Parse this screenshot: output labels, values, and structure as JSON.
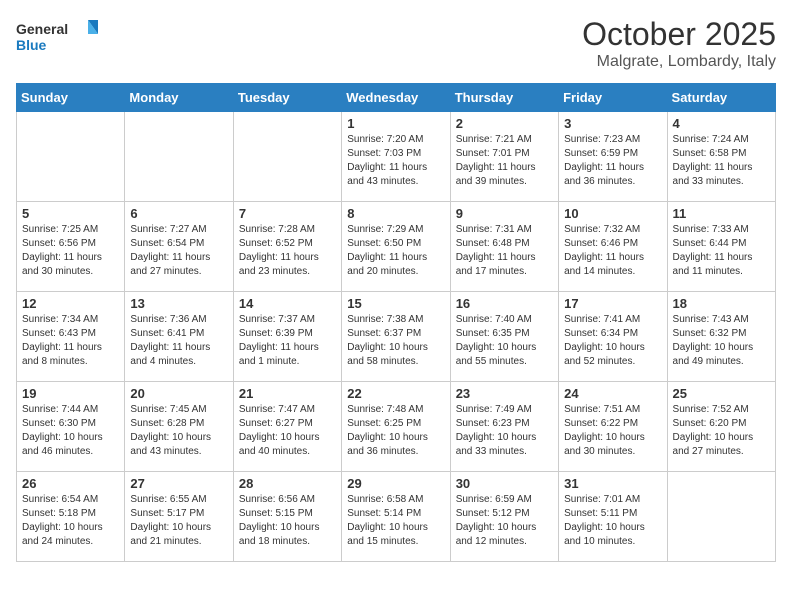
{
  "header": {
    "logo_line1": "General",
    "logo_line2": "Blue",
    "month": "October 2025",
    "location": "Malgrate, Lombardy, Italy"
  },
  "days_of_week": [
    "Sunday",
    "Monday",
    "Tuesday",
    "Wednesday",
    "Thursday",
    "Friday",
    "Saturday"
  ],
  "weeks": [
    [
      {
        "day": "",
        "info": ""
      },
      {
        "day": "",
        "info": ""
      },
      {
        "day": "",
        "info": ""
      },
      {
        "day": "1",
        "info": "Sunrise: 7:20 AM\nSunset: 7:03 PM\nDaylight: 11 hours\nand 43 minutes."
      },
      {
        "day": "2",
        "info": "Sunrise: 7:21 AM\nSunset: 7:01 PM\nDaylight: 11 hours\nand 39 minutes."
      },
      {
        "day": "3",
        "info": "Sunrise: 7:23 AM\nSunset: 6:59 PM\nDaylight: 11 hours\nand 36 minutes."
      },
      {
        "day": "4",
        "info": "Sunrise: 7:24 AM\nSunset: 6:58 PM\nDaylight: 11 hours\nand 33 minutes."
      }
    ],
    [
      {
        "day": "5",
        "info": "Sunrise: 7:25 AM\nSunset: 6:56 PM\nDaylight: 11 hours\nand 30 minutes."
      },
      {
        "day": "6",
        "info": "Sunrise: 7:27 AM\nSunset: 6:54 PM\nDaylight: 11 hours\nand 27 minutes."
      },
      {
        "day": "7",
        "info": "Sunrise: 7:28 AM\nSunset: 6:52 PM\nDaylight: 11 hours\nand 23 minutes."
      },
      {
        "day": "8",
        "info": "Sunrise: 7:29 AM\nSunset: 6:50 PM\nDaylight: 11 hours\nand 20 minutes."
      },
      {
        "day": "9",
        "info": "Sunrise: 7:31 AM\nSunset: 6:48 PM\nDaylight: 11 hours\nand 17 minutes."
      },
      {
        "day": "10",
        "info": "Sunrise: 7:32 AM\nSunset: 6:46 PM\nDaylight: 11 hours\nand 14 minutes."
      },
      {
        "day": "11",
        "info": "Sunrise: 7:33 AM\nSunset: 6:44 PM\nDaylight: 11 hours\nand 11 minutes."
      }
    ],
    [
      {
        "day": "12",
        "info": "Sunrise: 7:34 AM\nSunset: 6:43 PM\nDaylight: 11 hours\nand 8 minutes."
      },
      {
        "day": "13",
        "info": "Sunrise: 7:36 AM\nSunset: 6:41 PM\nDaylight: 11 hours\nand 4 minutes."
      },
      {
        "day": "14",
        "info": "Sunrise: 7:37 AM\nSunset: 6:39 PM\nDaylight: 11 hours\nand 1 minute."
      },
      {
        "day": "15",
        "info": "Sunrise: 7:38 AM\nSunset: 6:37 PM\nDaylight: 10 hours\nand 58 minutes."
      },
      {
        "day": "16",
        "info": "Sunrise: 7:40 AM\nSunset: 6:35 PM\nDaylight: 10 hours\nand 55 minutes."
      },
      {
        "day": "17",
        "info": "Sunrise: 7:41 AM\nSunset: 6:34 PM\nDaylight: 10 hours\nand 52 minutes."
      },
      {
        "day": "18",
        "info": "Sunrise: 7:43 AM\nSunset: 6:32 PM\nDaylight: 10 hours\nand 49 minutes."
      }
    ],
    [
      {
        "day": "19",
        "info": "Sunrise: 7:44 AM\nSunset: 6:30 PM\nDaylight: 10 hours\nand 46 minutes."
      },
      {
        "day": "20",
        "info": "Sunrise: 7:45 AM\nSunset: 6:28 PM\nDaylight: 10 hours\nand 43 minutes."
      },
      {
        "day": "21",
        "info": "Sunrise: 7:47 AM\nSunset: 6:27 PM\nDaylight: 10 hours\nand 40 minutes."
      },
      {
        "day": "22",
        "info": "Sunrise: 7:48 AM\nSunset: 6:25 PM\nDaylight: 10 hours\nand 36 minutes."
      },
      {
        "day": "23",
        "info": "Sunrise: 7:49 AM\nSunset: 6:23 PM\nDaylight: 10 hours\nand 33 minutes."
      },
      {
        "day": "24",
        "info": "Sunrise: 7:51 AM\nSunset: 6:22 PM\nDaylight: 10 hours\nand 30 minutes."
      },
      {
        "day": "25",
        "info": "Sunrise: 7:52 AM\nSunset: 6:20 PM\nDaylight: 10 hours\nand 27 minutes."
      }
    ],
    [
      {
        "day": "26",
        "info": "Sunrise: 6:54 AM\nSunset: 5:18 PM\nDaylight: 10 hours\nand 24 minutes."
      },
      {
        "day": "27",
        "info": "Sunrise: 6:55 AM\nSunset: 5:17 PM\nDaylight: 10 hours\nand 21 minutes."
      },
      {
        "day": "28",
        "info": "Sunrise: 6:56 AM\nSunset: 5:15 PM\nDaylight: 10 hours\nand 18 minutes."
      },
      {
        "day": "29",
        "info": "Sunrise: 6:58 AM\nSunset: 5:14 PM\nDaylight: 10 hours\nand 15 minutes."
      },
      {
        "day": "30",
        "info": "Sunrise: 6:59 AM\nSunset: 5:12 PM\nDaylight: 10 hours\nand 12 minutes."
      },
      {
        "day": "31",
        "info": "Sunrise: 7:01 AM\nSunset: 5:11 PM\nDaylight: 10 hours\nand 10 minutes."
      },
      {
        "day": "",
        "info": ""
      }
    ]
  ]
}
